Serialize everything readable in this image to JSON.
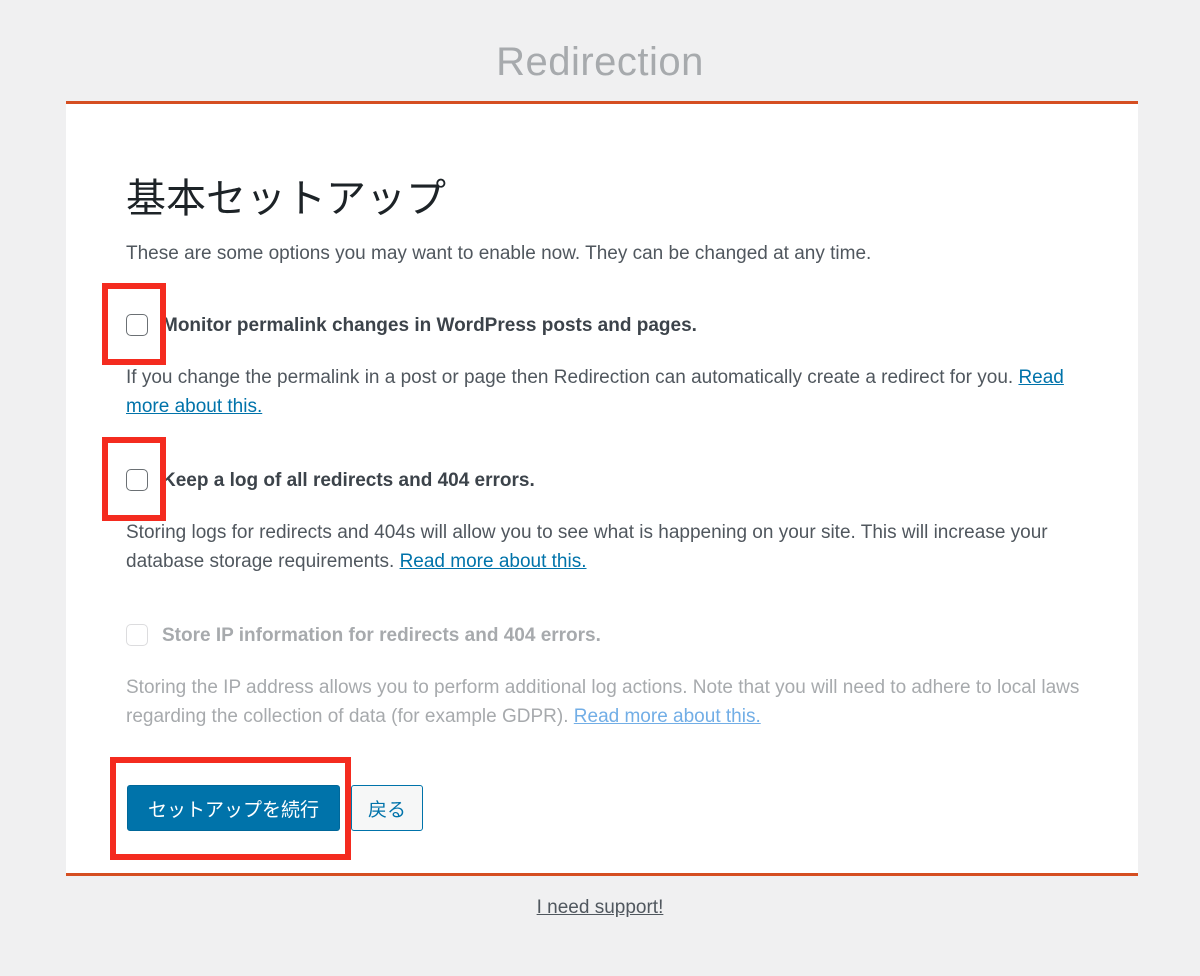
{
  "app": {
    "title": "Redirection"
  },
  "setup": {
    "heading": "基本セットアップ",
    "intro": "These are some options you may want to enable now. They can be changed at any time.",
    "options": [
      {
        "label": "Monitor permalink changes in WordPress posts and pages.",
        "description": "If you change the permalink in a post or page then Redirection can automatically create a redirect for you.",
        "link_text": "Read more about this.",
        "checked": false,
        "disabled": false
      },
      {
        "label": "Keep a log of all redirects and 404 errors.",
        "description": "Storing logs for redirects and 404s will allow you to see what is happening on your site. This will increase your database storage requirements.",
        "link_text": "Read more about this.",
        "checked": false,
        "disabled": false
      },
      {
        "label": "Store IP information for redirects and 404 errors.",
        "description": "Storing the IP address allows you to perform additional log actions. Note that you will need to adhere to local laws regarding the collection of data (for example GDPR).",
        "link_text": "Read more about this.",
        "checked": false,
        "disabled": true
      }
    ],
    "continue_button": "セットアップを続行",
    "back_button": "戻る"
  },
  "footer": {
    "support_link": "I need support!"
  },
  "colors": {
    "accent_border": "#d54e21",
    "primary_button": "#0073aa",
    "highlight_box": "#f42b1f"
  }
}
